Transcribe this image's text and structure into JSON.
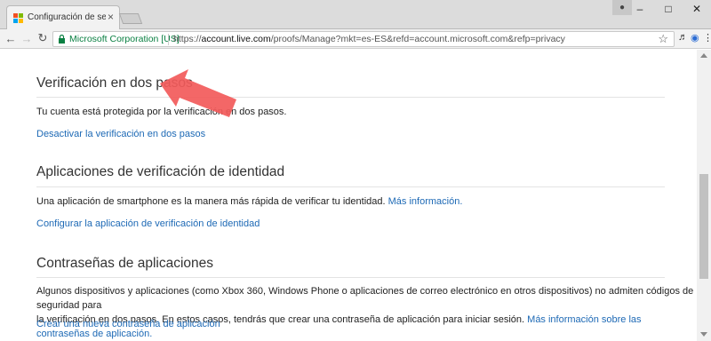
{
  "browser": {
    "tab_title": "Configuración de seguridad",
    "secure_label": "Microsoft Corporation [US]",
    "url_scheme": "https://",
    "url_domain": "account.live.com",
    "url_path": "/proofs/Manage?mkt=es-ES&refd=account.microsoft.com&refp=privacy",
    "icons": [
      "back-icon",
      "forward-icon",
      "reload-icon",
      "lock-icon",
      "star-icon",
      "speaker-icon",
      "extension-icon",
      "menu-icon"
    ]
  },
  "sections": [
    {
      "title": "Verificación en dos pasos",
      "text": "Tu cuenta está protegida por la verificación en dos pasos.",
      "link": "Desactivar la verificación en dos pasos"
    },
    {
      "title": "Aplicaciones de verificación de identidad",
      "text": "Una aplicación de smartphone es la manera más rápida de verificar tu identidad.",
      "inline_link": "Más información.",
      "link": "Configurar la aplicación de verificación de identidad"
    },
    {
      "title": "Contraseñas de aplicaciones",
      "text_line1": "Algunos dispositivos y aplicaciones (como Xbox 360, Windows Phone o aplicaciones de correo electrónico en otros dispositivos) no admiten códigos de seguridad para",
      "text_line2": "la verificación en dos pasos. En estos casos, tendrás que crear una contraseña de aplicación para iniciar sesión.",
      "inline_link": "Más información sobre las contraseñas de aplicación.",
      "link": "Crear una nueva contraseña de aplicación"
    }
  ],
  "colors": {
    "link": "#1d69b5",
    "secure": "#0b8043",
    "arrow": "#f25a5a"
  }
}
